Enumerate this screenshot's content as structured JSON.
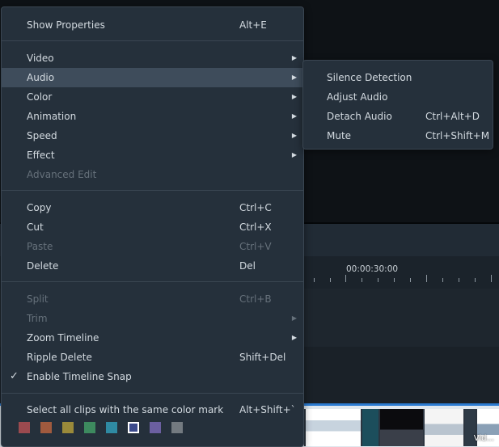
{
  "context_menu": {
    "show_properties": {
      "label": "Show Properties",
      "shortcut": "Alt+E"
    },
    "video": {
      "label": "Video"
    },
    "audio": {
      "label": "Audio"
    },
    "color": {
      "label": "Color"
    },
    "animation": {
      "label": "Animation"
    },
    "speed": {
      "label": "Speed"
    },
    "effect": {
      "label": "Effect"
    },
    "advanced_edit": {
      "label": "Advanced Edit"
    },
    "copy": {
      "label": "Copy",
      "shortcut": "Ctrl+C"
    },
    "cut": {
      "label": "Cut",
      "shortcut": "Ctrl+X"
    },
    "paste": {
      "label": "Paste",
      "shortcut": "Ctrl+V"
    },
    "delete": {
      "label": "Delete",
      "shortcut": "Del"
    },
    "split": {
      "label": "Split",
      "shortcut": "Ctrl+B"
    },
    "trim": {
      "label": "Trim"
    },
    "zoom_timeline": {
      "label": "Zoom Timeline"
    },
    "ripple_delete": {
      "label": "Ripple Delete",
      "shortcut": "Shift+Del"
    },
    "enable_snap": {
      "label": "Enable Timeline Snap",
      "checked": true
    },
    "select_same_color": {
      "label": "Select all clips with the same color mark",
      "shortcut": "Alt+Shift+`"
    },
    "color_marks": [
      "#9b4a4f",
      "#a05a3e",
      "#9a8a3a",
      "#3d8a5f",
      "#2f8aa3",
      "#3b4a8c",
      "#6b5fa0",
      "#737a80"
    ],
    "selected_color_mark_index": 5
  },
  "audio_submenu": {
    "silence_detection": {
      "label": "Silence Detection"
    },
    "adjust_audio": {
      "label": "Adjust Audio"
    },
    "detach_audio": {
      "label": "Detach Audio",
      "shortcut": "Ctrl+Alt+D"
    },
    "mute": {
      "label": "Mute",
      "shortcut": "Ctrl+Shift+M"
    }
  },
  "timeline": {
    "timecode": "00:00:30:00"
  },
  "watermark": "Vid..."
}
